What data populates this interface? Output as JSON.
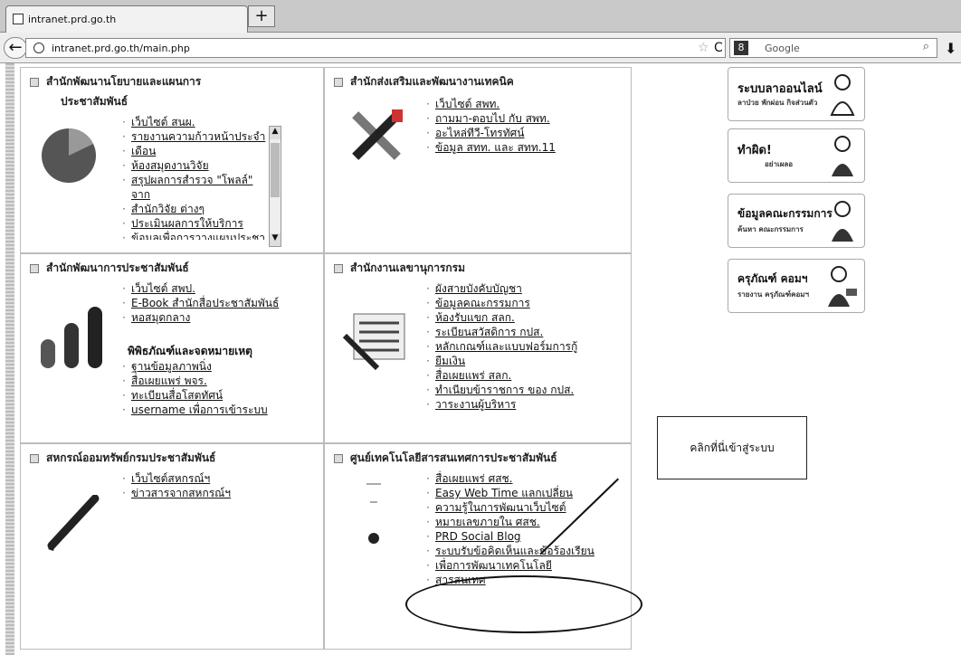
{
  "browser": {
    "tab_title": "intranet.prd.go.th",
    "new_tab": "+",
    "url": "intranet.prd.go.th/main.php",
    "search_placeholder": "Google",
    "search_engine_icon": "google-icon"
  },
  "cells": [
    {
      "title_line1": "สำนักพัฒนานโยบายและแผนการ",
      "title_line2": "ประชาสัมพันธ์",
      "links": [
        "เว็บไซต์ สนผ.",
        "รายงานความก้าวหน้าประจำ",
        "เดือน",
        "ห้องสมุดงานวิจัย",
        "สรุปผลการสำรวจ \"โพลล์\" จาก",
        "สำนักวิจัย ต่างๆ",
        "ประเมินผลการให้บริการ",
        "ข้อมูลเพื่อการวางแผนประชา"
      ]
    },
    {
      "title": "สำนักส่งเสริมและพัฒนางานเทคนิค",
      "links": [
        "เว็บไซต์ สพท.",
        "ถามมา-ตอบไป กับ สพท.",
        "อะไหล่ทีวี-โทรทัศน์",
        "ข้อมูล สทท. และ สทท.11"
      ]
    },
    {
      "title": "สำนักพัฒนาการประชาสัมพันธ์",
      "links": [
        "เว็บไซต์ สพป.",
        "E-Book สำนักสื่อประชาสัมพันธ์",
        "หอสมุดกลาง"
      ],
      "subhead": "พิพิธภัณฑ์และจดหมายเหตุ",
      "links2": [
        "ฐานข้อมูลภาพนิ่ง",
        "สื่อเผยแพร่ พจร.",
        "ทะเบียนสื่อโสตทัศน์",
        "username เพื่อการเข้าระบบ"
      ]
    },
    {
      "title": "สำนักงานเลขานุการกรม",
      "links": [
        "ผังสายบังคับบัญชา",
        "ข้อมูลคณะกรรมการ",
        "ห้องรับแขก สลก.",
        "ระเบียนสวัสดิการ กปส.",
        "หลักเกณฑ์และแบบฟอร์มการกู้",
        "ยืมเงิน",
        "สื่อเผยแพร่ สลก.",
        "ทำเนียบข้าราชการ ของ กปส.",
        "วาระงานผู้บริหาร"
      ]
    },
    {
      "title": "สหกรณ์ออมทรัพย์กรมประชาสัมพันธ์",
      "links": [
        "เว็บไซต์สหกรณ์ฯ",
        "ข่าวสารจากสหกรณ์ฯ"
      ]
    },
    {
      "title": "ศูนย์เทคโนโลยีสารสนเทศการประชาสัมพันธ์",
      "links": [
        "สื่อเผยแพร่ ศสช.",
        "Easy Web Time แลกเปลี่ยน",
        "ความรู้ในการพัฒนาเว็บไซต์",
        "หมายเลขภายใน ศสช.",
        "PRD Social Blog",
        "ระบบรับข้อคิดเห็นและข้อร้องเรียน",
        "เพื่อการพัฒนาเทคโนโลยี",
        "สารสนเทศ"
      ]
    }
  ],
  "side": [
    {
      "main": "ระบบลาออนไลน์",
      "sub": "ลาป่วย พักผ่อน กิจส่วนตัว"
    },
    {
      "main": "ทำผิด!",
      "sub": "อย่าเผลอ"
    },
    {
      "main": "ข้อมูลคณะกรรมการ",
      "sub": "ค้นหา คณะกรรมการ"
    },
    {
      "main": "ครุภัณฑ์ คอมฯ",
      "sub": "รายงาน ครุภัณฑ์คอมฯ"
    }
  ],
  "callout": "คลิกที่นี่เข้าสู่ระบบ"
}
